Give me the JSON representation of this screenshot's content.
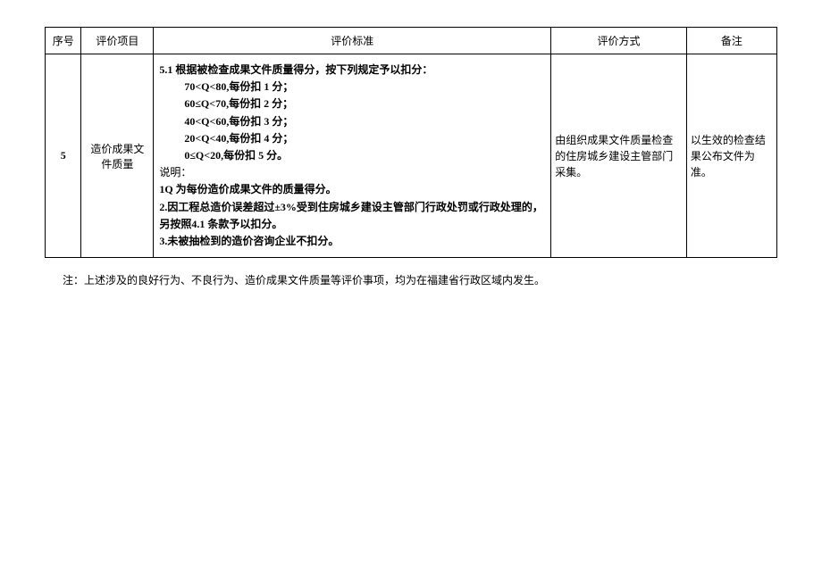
{
  "headers": {
    "seq": "序号",
    "item": "评价项目",
    "standard": "评价标准",
    "method": "评价方式",
    "remark": "备注"
  },
  "row": {
    "seq": "5",
    "item": "造价成果文件质量",
    "standard": {
      "title": "5.1 根据被检查成果文件质量得分，按下列规定予以扣分：",
      "rules": [
        "70<Q<80,每份扣 1 分；",
        "60≤Q<70,每份扣 2 分；",
        "40<Q<60,每份扣 3 分；",
        "20<Q<40,每份扣 4 分；",
        "0≤Q<20,每份扣 5 分。"
      ],
      "note_label": "说明：",
      "notes": [
        "1Q 为每份造价成果文件的质量得分。",
        "2.因工程总造价误差超过±3%受到住房城乡建设主管部门行政处罚或行政处理的，另按照4.1 条款予以扣分。",
        "3.未被抽检到的造价咨询企业不扣分。"
      ]
    },
    "method": "由组织成果文件质量检查的住房城乡建设主管部门采集。",
    "remark": "以生效的检查结果公布文件为准。"
  },
  "footnote": "注：上述涉及的良好行为、不良行为、造价成果文件质量等评价事项，均为在福建省行政区域内发生。"
}
